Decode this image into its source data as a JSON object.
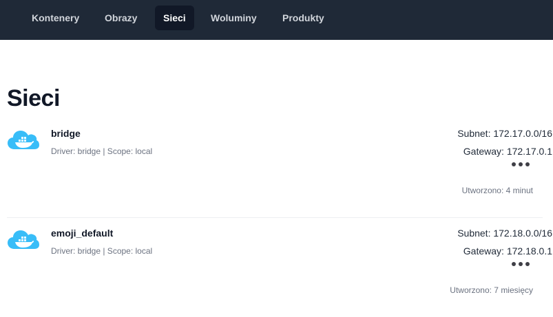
{
  "nav": {
    "tabs": [
      {
        "label": "Kontenery",
        "active": false
      },
      {
        "label": "Obrazy",
        "active": false
      },
      {
        "label": "Sieci",
        "active": true
      },
      {
        "label": "Woluminy",
        "active": false
      },
      {
        "label": "Produkty",
        "active": false
      }
    ]
  },
  "page": {
    "title": "Sieci"
  },
  "networks": [
    {
      "name": "bridge",
      "meta": "Driver: bridge | Scope: local",
      "subnet": "Subnet: 172.17.0.0/16",
      "gateway": "Gateway: 172.17.0.1",
      "created": "Utworzono: 4 minut",
      "icon": "docker-cloud-icon"
    },
    {
      "name": "emoji_default",
      "meta": "Driver: bridge | Scope: local",
      "subnet": "Subnet: 172.18.0.0/16",
      "gateway": "Gateway: 172.18.0.1",
      "created": "Utworzono: 7 miesięcy",
      "icon": "docker-cloud-icon"
    }
  ],
  "colors": {
    "nav_background": "#1f2937",
    "active_tab_background": "#111827",
    "icon_color": "#38bdf8"
  }
}
